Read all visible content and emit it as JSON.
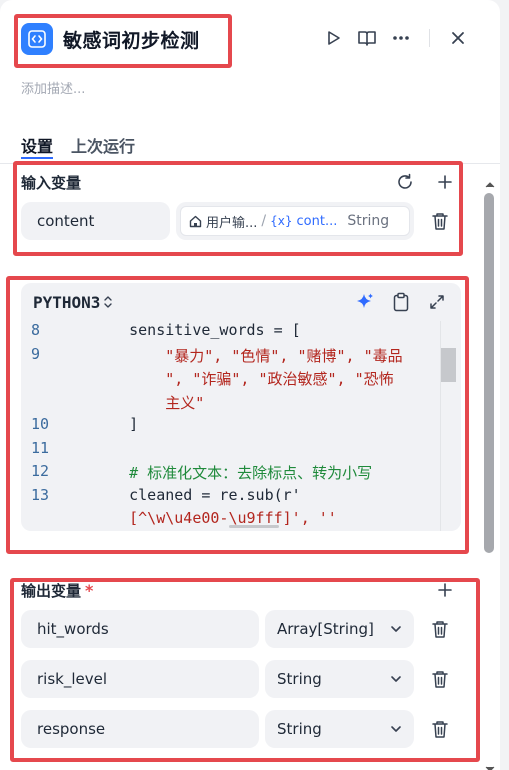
{
  "header": {
    "title": "敏感词初步检测",
    "description_placeholder": "添加描述..."
  },
  "tabs": [
    {
      "label": "设置",
      "active": true
    },
    {
      "label": "上次运行",
      "active": false
    }
  ],
  "input_section": {
    "title": "输入变量",
    "variables": [
      {
        "name": "content",
        "source_node": "用户输...",
        "separator": "/",
        "var_prefix": "{x}",
        "var_name": "cont...",
        "type": "String"
      }
    ]
  },
  "code": {
    "language": "PYTHON3",
    "lines": [
      {
        "num": "8",
        "parts": [
          {
            "t": "    sensitive_words = [",
            "c": ""
          }
        ]
      },
      {
        "num": "9",
        "parts": [
          {
            "t": "        \"暴力\", \"色情\", \"赌博\", \"毒品",
            "c": "str"
          }
        ]
      },
      {
        "num": "",
        "parts": [
          {
            "t": "        \", \"诈骗\", \"政治敏感\", \"恐怖",
            "c": "str"
          }
        ]
      },
      {
        "num": "",
        "parts": [
          {
            "t": "        主义\"",
            "c": "str"
          }
        ]
      },
      {
        "num": "10",
        "parts": [
          {
            "t": "    ]",
            "c": ""
          }
        ]
      },
      {
        "num": "11",
        "parts": [
          {
            "t": "",
            "c": ""
          }
        ]
      },
      {
        "num": "12",
        "parts": [
          {
            "t": "    # 标准化文本：去除标点、转为小写",
            "c": "cmt"
          }
        ]
      },
      {
        "num": "13",
        "parts": [
          {
            "t": "    cleaned = re.sub(r'",
            "c": ""
          }
        ]
      },
      {
        "num": "",
        "parts": [
          {
            "t": "    [^\\w\\u4e00-\\u9fff]', ''",
            "c": "str"
          }
        ]
      }
    ]
  },
  "output_section": {
    "title": "输出变量",
    "required_mark": "*",
    "variables": [
      {
        "name": "hit_words",
        "type": "Array[String]"
      },
      {
        "name": "risk_level",
        "type": "String"
      },
      {
        "name": "response",
        "type": "String"
      }
    ]
  },
  "colors": {
    "accent": "#2f80ff",
    "highlight_box": "#e5484d",
    "string": "#b3261e",
    "comment": "#1f8a3b"
  }
}
